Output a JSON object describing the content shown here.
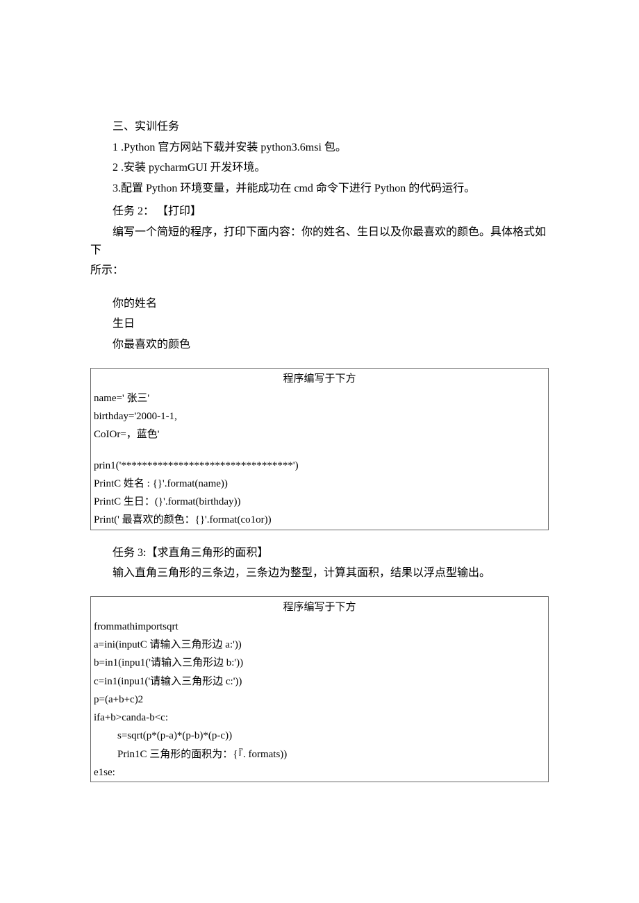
{
  "section_title": "三、实训任务",
  "tasks_intro": {
    "item1": "1  .Python 官方网站下载并安装 python3.6msi 包。",
    "item2": "2   .安装 pycharmGUI 开发环境。",
    "item3": "3.配置 Python 环境变量，并能成功在 cmd 命令下进行 Python 的代码运行。"
  },
  "task2": {
    "title": "任务 2： 【打印】",
    "desc": "编写一个简短的程序，打印下面内容：你的姓名、生日以及你最喜欢的颜色。具体格式如下",
    "desc_cont": "所示：",
    "line1": "你的姓名",
    "line2": "生日",
    "line3": "你最喜欢的颜色",
    "header": "程序编写于下方",
    "code": {
      "l1": "name=' 张三'",
      "l2": "birthday='2000-1-1,",
      "l3": "CoIOr=，蓝色'",
      "l4": "prin1('*********************************')",
      "l5": "PrintC 姓名 : {}'.format(name))",
      "l6": "PrintC 生日：(}'.format(birthday))",
      "l7": "Print(' 最喜欢的颜色：{}'.format(co1or))"
    }
  },
  "task3": {
    "title": "任务 3:【求直角三角形的面积】",
    "desc": "输入直角三角形的三条边，三条边为整型，计算其面积，结果以浮点型输出。",
    "header": "程序编写于下方",
    "code": {
      "l1": "frommathimportsqrt",
      "l2": "a=ini(inputC 请输入三角形边 a:'))",
      "l3": "b=in1(inpu1('请输入三角形边 b:'))",
      "l4": "c=in1(inpu1('请输入三角形边 c:'))",
      "l5": "p=(a+b+c)2",
      "l6": "ifa+b>canda-b<c:",
      "l7": "s=sqrt(p*(p-a)*(p-b)*(p-c))",
      "l8": "Prin1C 三角形的面积为：{『. formats))",
      "l9": "e1se:"
    }
  }
}
